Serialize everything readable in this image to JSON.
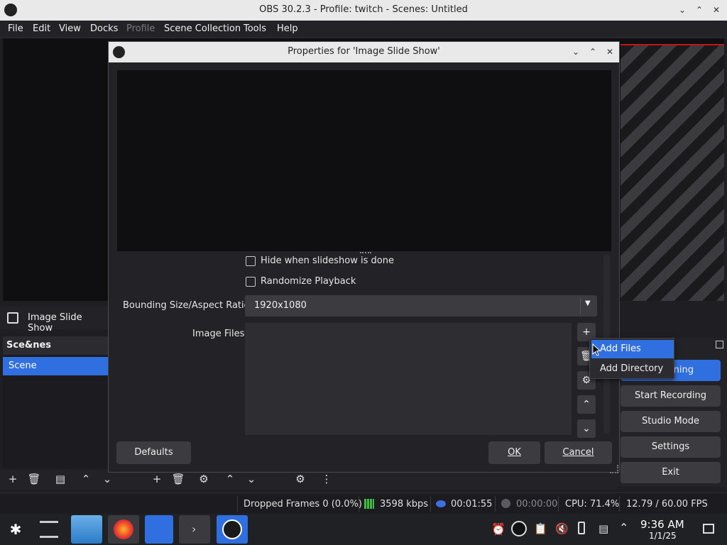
{
  "window": {
    "title": "OBS 30.2.3 - Profile: twitch - Scenes: Untitled"
  },
  "menu": [
    "File",
    "Edit",
    "View",
    "Docks",
    "Profile",
    "Scene Collection",
    "Tools",
    "Help"
  ],
  "sources_bar": {
    "label": "Image Slide Show"
  },
  "scenes": {
    "header": "Sce&nes",
    "items": [
      "Scene"
    ]
  },
  "controls": {
    "streaming_partial": "ning",
    "start_recording": "Start Recording",
    "studio_mode": "Studio Mode",
    "settings": "Settings",
    "exit": "Exit"
  },
  "status": {
    "dropped_frames": "Dropped Frames 0 (0.0%)",
    "bitrate": "3598 kbps",
    "stream_time": "00:01:55",
    "rec_time": "00:00:00",
    "cpu": "CPU: 71.4%",
    "fps": "12.79 / 60.00 FPS"
  },
  "dialog": {
    "title": "Properties for 'Image Slide Show'",
    "hide_when_done": "Hide when slideshow is done",
    "randomize": "Randomize Playback",
    "bounding_label": "Bounding Size/Aspect Ratio",
    "bounding_value": "1920x1080",
    "image_files_label": "Image Files",
    "defaults": "Defaults",
    "ok": "OK",
    "cancel": "Cancel"
  },
  "popup": {
    "add_files": "Add Files",
    "add_directory": "Add Directory"
  },
  "taskbar": {
    "time": "9:36 AM",
    "date": "1/1/25"
  },
  "colors": {
    "accent": "#2f6fe0",
    "live_bar": "#c01818",
    "signal": "#3cc03c"
  },
  "icons": [
    "obs-logo-icon",
    "minimize-icon",
    "maximize-icon",
    "close-icon",
    "plus-icon",
    "trash-icon",
    "gear-icon",
    "chevron-up-icon",
    "chevron-down-icon",
    "filter-icon",
    "mouse-cursor-icon",
    "slideshow-icon",
    "signal-icon",
    "record-dot-icon",
    "stream-icon"
  ]
}
